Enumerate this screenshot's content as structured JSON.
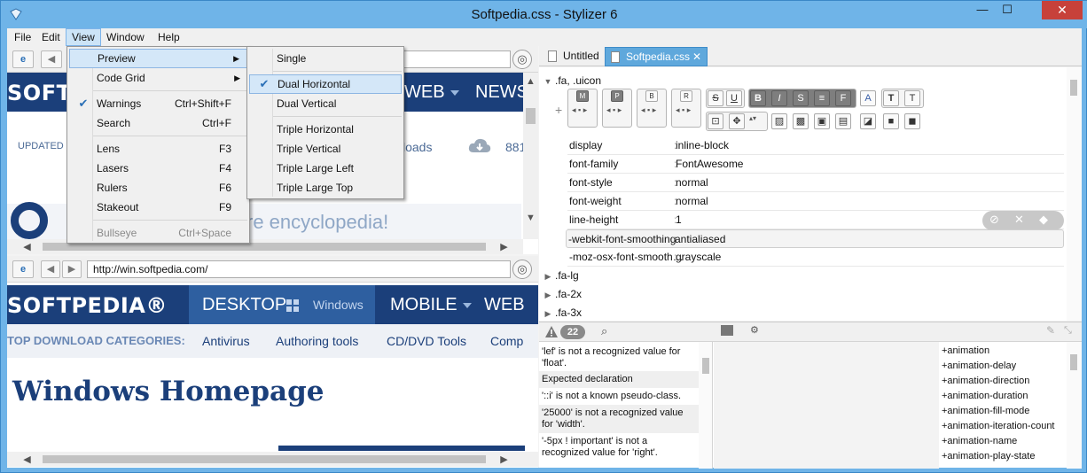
{
  "window": {
    "title": "Softpedia.css - Stylizer 6",
    "min": "—",
    "max": "☐",
    "close": "✕"
  },
  "menubar": [
    "File",
    "Edit",
    "View",
    "Window",
    "Help"
  ],
  "view_menu": {
    "items": [
      {
        "label": "Preview",
        "shortcut": "",
        "submenu": true
      },
      {
        "label": "Code Grid",
        "shortcut": "",
        "submenu": true
      },
      {
        "label": "Warnings",
        "shortcut": "Ctrl+Shift+F",
        "checked": true
      },
      {
        "label": "Search",
        "shortcut": "Ctrl+F"
      },
      {
        "label": "Lens",
        "shortcut": "F3"
      },
      {
        "label": "Lasers",
        "shortcut": "F4"
      },
      {
        "label": "Rulers",
        "shortcut": "F6"
      },
      {
        "label": "Stakeout",
        "shortcut": "F9"
      },
      {
        "label": "Bullseye",
        "shortcut": "Ctrl+Space",
        "disabled": true
      }
    ]
  },
  "preview_menu": {
    "items": [
      "Single",
      "Dual Horizontal",
      "Dual Vertical",
      "Triple Horizontal",
      "Triple Vertical",
      "Triple Large Left",
      "Triple Large Top"
    ],
    "checked": "Dual Horizontal"
  },
  "top_pane": {
    "nav_web": "WEB",
    "nav_news": "NEWS",
    "logo_partial": "SOFT",
    "updated": "UPDATED O",
    "downloads": "loads",
    "count": "881",
    "tagline": "re encyclopedia!"
  },
  "bottom_pane": {
    "url": "http://win.softpedia.com/",
    "logo": "SOFTPEDIA®",
    "nav": [
      "DESKTOP",
      "Windows",
      "MOBILE",
      "WEB"
    ],
    "categories_label": "TOP DOWNLOAD CATEGORIES:",
    "categories": [
      "Antivirus",
      "Authoring tools",
      "CD/DVD Tools",
      "Comp"
    ],
    "heading": "Windows Homepage"
  },
  "tabs": [
    "Untitled",
    "Softpedia.css"
  ],
  "rules": {
    "selector": ".fa, .uicon",
    "properties": [
      {
        "name": "display",
        "value": "inline-block"
      },
      {
        "name": "font-family",
        "value": "FontAwesome"
      },
      {
        "name": "font-style",
        "value": "normal"
      },
      {
        "name": "font-weight",
        "value": "normal"
      },
      {
        "name": "line-height",
        "value": "1"
      },
      {
        "name": "-webkit-font-smoothing",
        "value": "antialiased"
      },
      {
        "name": "-moz-osx-font-smooth…",
        "value": "grayscale"
      }
    ],
    "collapsed": [
      ".fa-lg",
      ".fa-2x",
      ".fa-3x"
    ]
  },
  "warnings": {
    "count": "22",
    "messages": [
      "'lef' is not a recognized value for 'float'.",
      "Expected declaration",
      "'::i' is not a known pseudo-class.",
      "'25000' is not a recognized value for 'width'.",
      "'-5px ! important' is not a recognized value for 'right'."
    ]
  },
  "autocomplete": [
    "+animation",
    "+animation-delay",
    "+animation-direction",
    "+animation-duration",
    "+animation-fill-mode",
    "+animation-iteration-count",
    "+animation-name",
    "+animation-play-state"
  ]
}
